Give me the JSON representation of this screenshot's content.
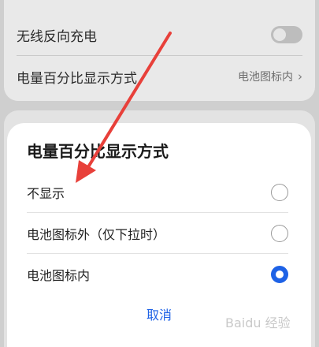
{
  "settings": {
    "wireless_reverse_label": "无线反向充电",
    "battery_percentage_label": "电量百分比显示方式",
    "battery_percentage_value": "电池图标内"
  },
  "dialog": {
    "title": "电量百分比显示方式",
    "options": [
      {
        "label": "不显示",
        "selected": false
      },
      {
        "label": "电池图标外（仅下拉时）",
        "selected": false
      },
      {
        "label": "电池图标内",
        "selected": true
      }
    ],
    "cancel_label": "取消"
  },
  "annotation": {
    "arrow_color": "#e8403a"
  },
  "colors": {
    "accent": "#1e62e6",
    "sheet": "#ffffff",
    "background": "#cfcfcf"
  },
  "watermark": "Baidu 经验"
}
